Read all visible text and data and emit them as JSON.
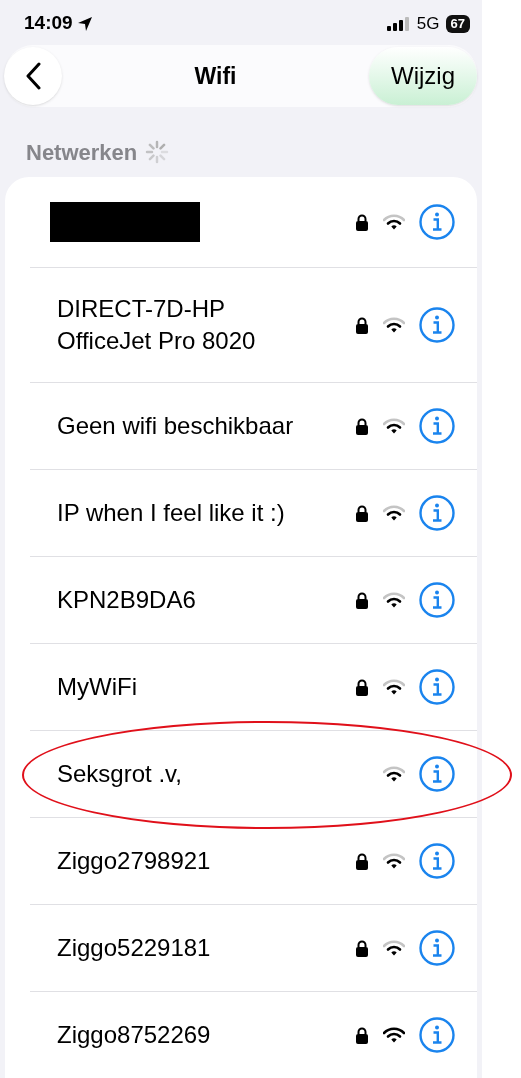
{
  "status_bar": {
    "time": "14:09",
    "network": "5G",
    "battery": "67"
  },
  "nav": {
    "title": "Wifi",
    "action": "Wijzig"
  },
  "section": {
    "title": "Netwerken",
    "loading": true
  },
  "networks": [
    {
      "redacted": true,
      "locked": true,
      "full_signal": false,
      "circled": false
    },
    {
      "name": "DIRECT-7D-HP OfficeJet Pro 8020",
      "redacted": false,
      "locked": true,
      "full_signal": false,
      "circled": false
    },
    {
      "name": "Geen wifi beschikbaar",
      "redacted": false,
      "locked": true,
      "full_signal": false,
      "circled": false
    },
    {
      "name": "IP when I feel like it :)",
      "redacted": false,
      "locked": true,
      "full_signal": false,
      "circled": false
    },
    {
      "name": "KPN2B9DA6",
      "redacted": false,
      "locked": true,
      "full_signal": false,
      "circled": false
    },
    {
      "name": "MyWiFi",
      "redacted": false,
      "locked": true,
      "full_signal": false,
      "circled": false
    },
    {
      "name": "Seksgrot .v,",
      "redacted": false,
      "locked": false,
      "full_signal": false,
      "circled": true
    },
    {
      "name": "Ziggo2798921",
      "redacted": false,
      "locked": true,
      "full_signal": false,
      "circled": false
    },
    {
      "name": "Ziggo5229181",
      "redacted": false,
      "locked": true,
      "full_signal": false,
      "circled": false
    },
    {
      "name": "Ziggo8752269",
      "redacted": false,
      "locked": true,
      "full_signal": true,
      "circled": false
    }
  ]
}
